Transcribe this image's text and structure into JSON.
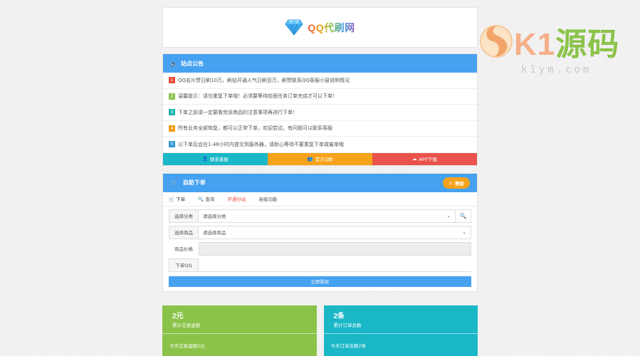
{
  "header": {
    "title": "QQ代刷网"
  },
  "notice": {
    "title": "站点公告",
    "items": [
      {
        "num": "1",
        "text": "QQ名片赞日刷10万，刷钻开通人气日刷百万，刷赞联系QQ客服小窗说明情况"
      },
      {
        "num": "2",
        "text": "温馨提示：请勿重复下单哦！必须要等待前面任务订单完成才可以下单！"
      },
      {
        "num": "3",
        "text": "下单之前请一定要看完该商品的注意事项再进行下单！"
      },
      {
        "num": "4",
        "text": "所有业务全部恢复，都可以正常下单，欢迎尝试，有问题可以联系客服"
      },
      {
        "num": "5",
        "text": "以下单后会在1-48小时内提交到服务器，请耐心等待不要重复下单或催单哦"
      }
    ],
    "buttons": [
      "联系客服",
      "官方Q群",
      "APP下载"
    ]
  },
  "order": {
    "title": "自助下单",
    "help_label": "帮助",
    "tabs": [
      "下单",
      "查询",
      "开通分站",
      "高级功能"
    ],
    "fields": [
      {
        "label": "选择分类",
        "value": "请选择分类"
      },
      {
        "label": "选择商品",
        "value": "请选择商品"
      },
      {
        "label": "商品价格",
        "value": ""
      },
      {
        "label": "下单QQ",
        "value": ""
      }
    ],
    "submit_label": "立即购买"
  },
  "stats": [
    {
      "value": "2元",
      "label": "累计交易金额",
      "foot": "今天交易金额2元"
    },
    {
      "value": "2条",
      "label": "累计订单总数",
      "foot": "今天订单总数2条"
    }
  ],
  "watermark": {
    "brand_latin": "K1",
    "brand_cn": "源码",
    "domain": "k1ym.com"
  },
  "colors": {
    "primary": "#46a1f1",
    "orange": "#f7a21b",
    "red": "#e9534b",
    "teal": "#1ab7c7",
    "green": "#8bc34a"
  },
  "icons": {
    "notice": "speaker-icon",
    "order": "cart-icon",
    "help": "warning-icon",
    "search": "search-icon"
  }
}
